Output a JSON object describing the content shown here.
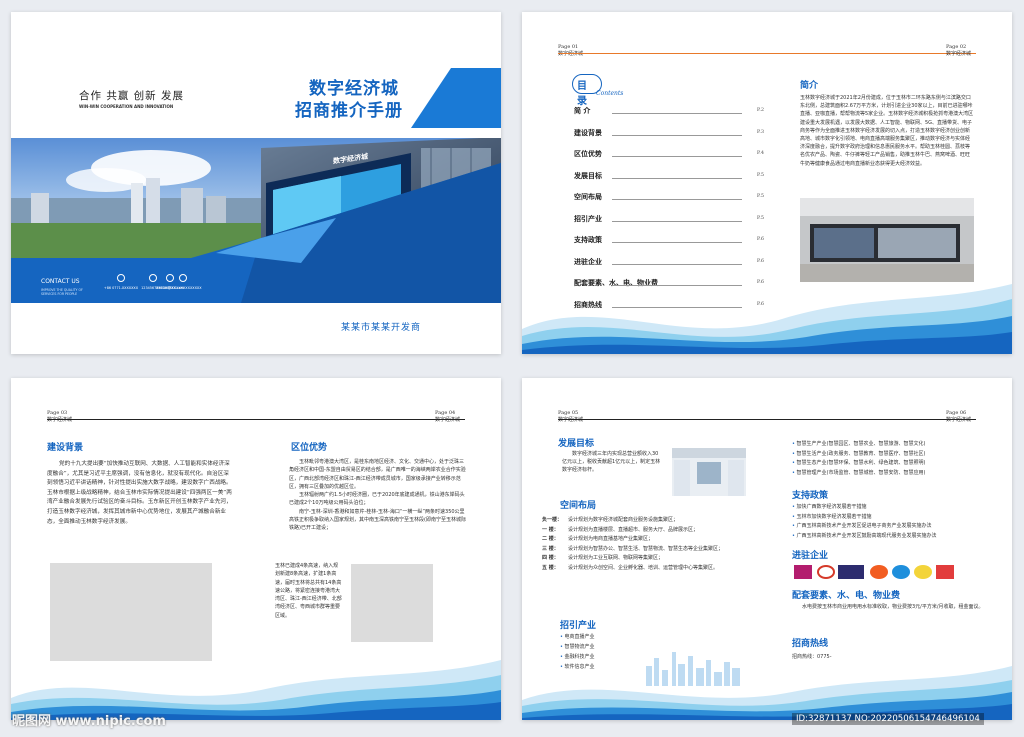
{
  "cover": {
    "slogan": "合作 共赢 创新 发展",
    "slogan_en": "WIN-WIN COOPERATION AND INNOVATION",
    "title_line1": "数字经济城",
    "title_line2": "招商推介手册",
    "sign_text": "数字经济城",
    "contact_label": "CONTACT US",
    "contact_sub": "IMPROVE THE QUALITY OF SERVICES FOR PEOPLE",
    "contacts": [
      "+86 0771-XXXXXXX",
      "12345678901",
      "XXXXX@XX.com",
      "XXXXXXXXXXXXXXXX"
    ],
    "developer": "某某市某某开发商"
  },
  "spread1": {
    "page_left": "Page 01",
    "page_left_sub": "数字经济城",
    "page_right": "Page 02",
    "page_right_sub": "数字经济城",
    "toc_title": "目录",
    "toc_title_en": "Contents",
    "toc": [
      {
        "label": "简  介",
        "page": "P.2"
      },
      {
        "label": "建设背景",
        "page": "P.3"
      },
      {
        "label": "区位优势",
        "page": "P.4"
      },
      {
        "label": "发展目标",
        "page": "P.5"
      },
      {
        "label": "空间布局",
        "page": "P.5"
      },
      {
        "label": "招引产业",
        "page": "P.5"
      },
      {
        "label": "支持政策",
        "page": "P.6"
      },
      {
        "label": "进驻企业",
        "page": "P.6"
      },
      {
        "label": "配套要素、水、电、物业费",
        "page": "P.6"
      },
      {
        "label": "招商热线",
        "page": "P.6"
      }
    ],
    "intro_title": "简介",
    "intro_text": "玉林数字经济城于2021年2月份建成，位于玉林市二环东路东侧与江滨路交口东北侧，总建筑面积2.67万平方米，计划引进企业30家以上，目前已进驻哪咔直播、亚咖直播，帮帮物流等5家企业。玉林数字经济城积极抢抓粤港澳大湾区建设重大发展机遇，以发展大数据、人工智能、物联网、5G、直播带货、电子商务等作为全面推进玉林数字经济发展的切入点，打造玉林数字经济创业创新高地、城市数字化引领地、电商直播高端服务集聚区，推动数字经济与实体经济深度融合，提升数字政府治理和信息惠民服务水平。帮助玉林桂圆、荔枝等名优农产品、陶瓷、牛仔裤等轻工产品销售，助推玉林牛巴、燕窝啤酒、旺旺牛奶等健康食品通过电商直播新业态获得更大经济效益。"
  },
  "spread2": {
    "page_left": "Page 03",
    "page_left_sub": "数字经济城",
    "page_right": "Page 04",
    "page_right_sub": "数字经济城",
    "bg_title": "建设背景",
    "bg_text": "党的十九大提出要“加快推动互联网、大数据、人工智能和实体经济深度融合”，尤其是习近平主席强调，没有信息化，就没有现代化。自治区深刻领悟习近平讲话精神，针对性提出实施大数字战略，建设数字广西战略。玉林市根据上级战略精神，结合玉林市实际情况提出建设“四强两区一美”两湾产业融合发展先行试验区的奋斗目标。玉东新区开创玉林数字产业先河，打造玉林数字经济城，发挥其城市新中心优势地位，发展其产城融合新业态，全面推动玉林数字经济发展。",
    "loc_title": "区位优势",
    "loc_text1": "玉林毗邻粤港澳大湾区，是桂东南地区经济、文化、交通中心，处于泛珠三角经济区和中国-东盟自由贸易区的结合部，是广西唯一的海峡两岸农业合作实验区，广西北部湾经济区和珠江-西江经济带成员城市，国家级承接产业转移示范区，拥有三区叠加的优越区位。",
    "loc_text2": "玉林辐射两广约1.5小时经济圈，已于2020年底建成通机，铁山港东岸码头已建成2个10万吨级公用码头泊位；",
    "loc_text3": "南宁-玉林-深圳-香港和如意芹-桂林-玉林-海口“一横一纵”两条时速350公里高铁正积极争取纳入国家规划，其中南玉深高铁南宁至玉林段(即南宁至玉林城际铁路)已开工建设；",
    "loc_text4": "玉林已建成4条高速，纳入规划新建8条高速，扩建1条高速，届时玉林将总共有14条高速公路，将紧密连接粤港湾大湾区、珠江-西江经济带、北部湾经济区、粤西城市群等重要区域。"
  },
  "spread3": {
    "page_left": "Page 05",
    "page_left_sub": "数字经济城",
    "page_right": "Page 06",
    "page_right_sub": "数字经济城",
    "goal_title": "发展目标",
    "goal_text": "数字经济城三年内实现总营业额收入30亿元以上，税收贡献超1亿元以上，制定玉林数字经济标杆。",
    "layout_title": "空间布局",
    "layout_items": [
      {
        "floor": "负一楼：",
        "text": "设计规划为数字经济城配套商业服务设施集聚区；"
      },
      {
        "floor": "一  楼：",
        "text": "设计规划为直播楼层、直播超市、服务大厅、品牌展示区；"
      },
      {
        "floor": "二  楼：",
        "text": "设计规划为电商直播基地产业集聚区；"
      },
      {
        "floor": "三  楼：",
        "text": "设计规划为智慧办公、智慧生活、智慧物流、智慧生态等企业集聚区；"
      },
      {
        "floor": "四  楼：",
        "text": "设计规划为工业互联网、物联网等集聚区；"
      },
      {
        "floor": "五  楼：",
        "text": "设计规划为众创空间、企业孵化器、培训、运营管理中心等集聚区。"
      }
    ],
    "industry_title": "招引产业",
    "industry_items": [
      "电商直播产业",
      "智慧物流产业",
      "金融科技产业",
      "软件信息产业"
    ],
    "smart_items": [
      "智慧生产产业(智慧园区、智慧农业、智慧旅游、智慧文化)",
      "智慧生活产业(政务服务、智慧教育、智慧医疗、智慧社区)",
      "智慧生态产业(智慧环保、智慧水利、绿色建筑、智慧照明)",
      "智慧管理产业(市场监管、智慧城管、智慧安防、智慧应用)"
    ],
    "policy_title": "支持政策",
    "policy_items": [
      "加快广西数字经济发展若干措施",
      "玉林市加快数字经济发展若干措施",
      "广西玉林高新技术产业开发区促进电子商务产业发展实施办法",
      "广西玉林高新技术产业开发区鼓励高端现代服务业发展实施办法"
    ],
    "enterprise_title": "进驻企业",
    "support_title": "配套要素、水、电、物业费",
    "support_text": "水电费按玉林市商业用电用水标准收取，物业费按3元/平方米/月收取，租金面议。",
    "hotline_title": "招商热线",
    "hotline_text": "招商热线：0775-"
  },
  "watermark": {
    "left": "昵图网 www.nipic.com",
    "right": "ID:32871137 NO:20220506154746496104"
  },
  "colors": {
    "primary": "#1565c0",
    "accent": "#e8792a",
    "light": "#5aa7e6"
  }
}
